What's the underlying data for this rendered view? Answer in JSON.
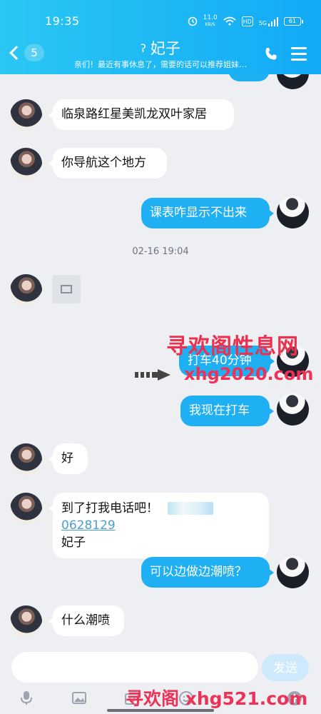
{
  "status_bar": {
    "time": "19:35",
    "speed": "11.0",
    "speed_unit": "KB/S",
    "network_type": "5G",
    "hd_label": "HD",
    "battery": "61"
  },
  "header": {
    "back_count": "5",
    "title": "妃子",
    "subtitle": "亲们！最近有事休息了，需要的话可以推荐姐妹…",
    "icons": {
      "back": "chevron-left-icon",
      "ear": "ear-icon",
      "phone": "phone-icon",
      "menu": "menu-icon"
    }
  },
  "chat": {
    "messages": [
      {
        "side": "left",
        "text": "临泉路红星美凯龙双叶家居"
      },
      {
        "side": "left",
        "text": "你导航这个地方"
      },
      {
        "side": "right",
        "text": "课表咋显示不出来"
      },
      {
        "type": "timestamp",
        "text": "02-16 19:04"
      },
      {
        "side": "left",
        "type": "image"
      },
      {
        "side": "right",
        "text": "打车40分钟"
      },
      {
        "side": "right",
        "text": "我现在打车"
      },
      {
        "side": "left",
        "text": "好"
      },
      {
        "side": "left",
        "text_prefix": "到了打我电话吧！",
        "phone_suffix": "0628129",
        "text_suffix": "妃子"
      },
      {
        "side": "right",
        "text": "可以边做边潮喷？"
      },
      {
        "side": "left",
        "text": "什么潮喷"
      }
    ]
  },
  "watermarks": {
    "top": "寻欢阁性息网",
    "middle": "xhg2020.com",
    "bottom": "寻欢阁 xhg521.com"
  },
  "composer": {
    "placeholder": "",
    "send_label": "发送"
  },
  "bottom_toolbar": {
    "icons": [
      "microphone-icon",
      "image-icon",
      "camera-icon",
      "emoji-icon",
      "plus-icon"
    ]
  },
  "colors": {
    "accent": "#1fb0f4",
    "watermark": "#eb314f",
    "background": "#edeff2"
  }
}
